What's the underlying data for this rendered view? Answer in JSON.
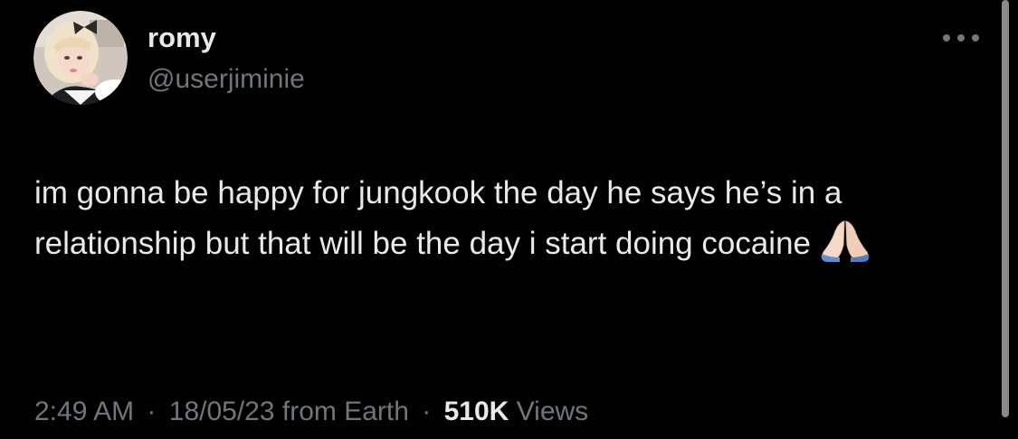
{
  "author": {
    "display_name": "romy",
    "handle": "@userjiminie"
  },
  "menu": {
    "icon": "more-horizontal-icon"
  },
  "tweet": {
    "text": "im gonna be happy for jungkook the day he says he’s in a relationship but that will be the day i start doing cocaine",
    "emoji": "folded-hands-icon"
  },
  "meta": {
    "time": "2:49 AM",
    "separator": "·",
    "date": "18/05/23",
    "source": "from Earth",
    "views_count": "510K",
    "views_label": "Views"
  },
  "colors": {
    "background": "#000000",
    "primary_text": "#e7e9ea",
    "secondary_text": "#71767b"
  }
}
